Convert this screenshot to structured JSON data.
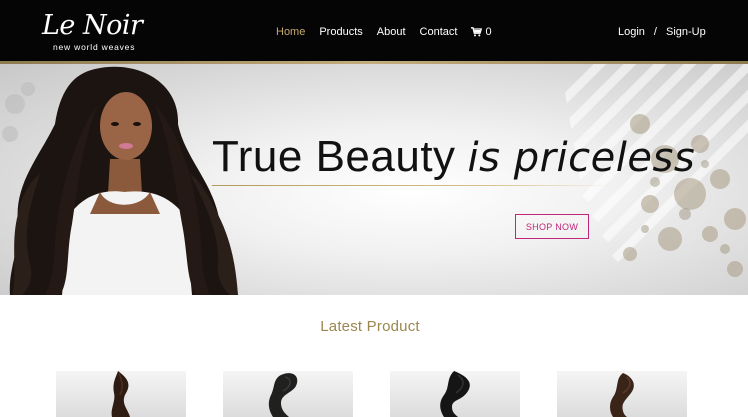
{
  "brand": {
    "logo_script": "Le Noir",
    "tagline": "new world weaves"
  },
  "nav": {
    "items": [
      {
        "label": "Home",
        "active": true
      },
      {
        "label": "Products",
        "active": false
      },
      {
        "label": "About",
        "active": false
      },
      {
        "label": "Contact",
        "active": false
      }
    ],
    "cart_icon": "shopping-cart-icon",
    "cart_count": "0"
  },
  "auth": {
    "login": "Login",
    "separator": "/",
    "signup": "Sign-Up"
  },
  "hero": {
    "headline_upright": "True Beauty",
    "headline_italic": "is priceless",
    "cta_label": "SHOP NOW"
  },
  "latest": {
    "title": "Latest Product",
    "products": [
      {
        "image": "hair-bundle-image"
      },
      {
        "image": "hair-bundle-image"
      },
      {
        "image": "hair-bundle-image"
      },
      {
        "image": "hair-bundle-image"
      }
    ]
  },
  "colors": {
    "header_bg": "#050505",
    "accent_gold": "#c7a96b",
    "cta_pink": "#c0267a",
    "section_title": "#9b874f"
  }
}
